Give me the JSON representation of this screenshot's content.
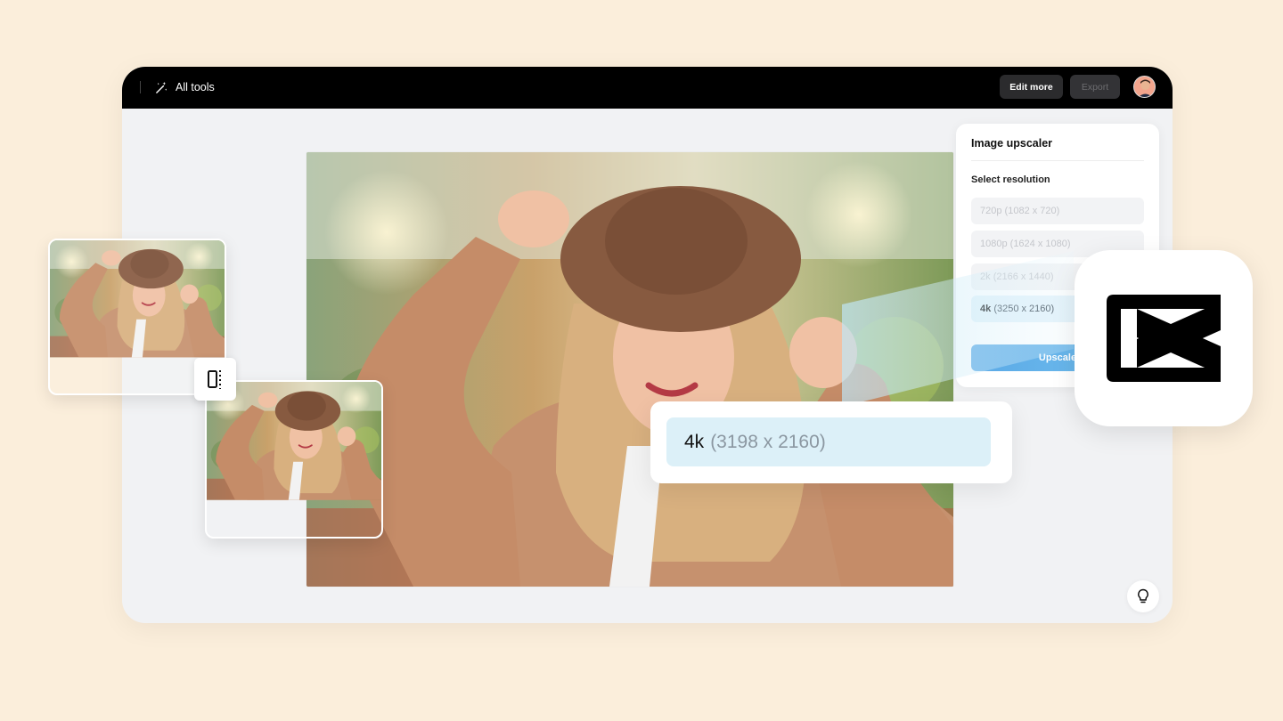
{
  "topbar": {
    "all_tools_label": "All tools",
    "edit_more_label": "Edit more",
    "export_label": "Export"
  },
  "panel": {
    "title": "Image upscaler",
    "subtitle": "Select resolution",
    "options": [
      {
        "label": "720p",
        "dims": "(1082 x 720)"
      },
      {
        "label": "1080p",
        "dims": "(1624 x 1080)"
      },
      {
        "label": "2k",
        "dims": "(2166 x 1440)"
      },
      {
        "label": "4k",
        "dims": "(3250 x 2160)"
      }
    ],
    "selected_index": 3,
    "upscale_label": "Upscale"
  },
  "callout": {
    "label": "4k",
    "dims": "(3198 x 2160)"
  },
  "icons": {
    "magic_wand": "magic-wand-icon",
    "bulb": "lightbulb-icon",
    "compare": "compare-split-icon",
    "logo": "capcut-logo-icon"
  },
  "colors": {
    "background": "#fbeedb",
    "topbar": "#000000",
    "accent": "#5aa9e6",
    "selected_option": "#e4f3fb"
  }
}
